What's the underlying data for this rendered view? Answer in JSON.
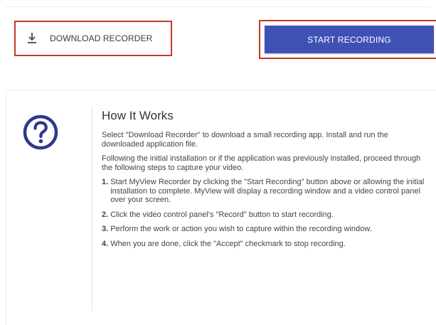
{
  "actions": {
    "download_label": "DOWNLOAD RECORDER",
    "start_label": "START RECORDING",
    "accent_color": "#3f51b5",
    "highlight_color": "#c0392b",
    "download_icon": "download-icon"
  },
  "how_it_works": {
    "icon": "question-circle-icon",
    "title": "How It Works",
    "paragraphs": [
      "Select \"Download Recorder\" to download a small recording app. Install and run the downloaded application file.",
      "Following the initial installation or if the application was previously installed, proceed through the following steps to capture your video."
    ],
    "steps": [
      {
        "num": "1.",
        "text": "Start MyView Recorder by clicking the \"Start Recording\" button above or allowing the initial installation to complete. MyView will display a recording window and a video control panel over your screen."
      },
      {
        "num": "2.",
        "text": "Click the video control panel's \"Record\" button to start recording."
      },
      {
        "num": "3.",
        "text": "Perform the work or action you wish to capture within the recording window."
      },
      {
        "num": "4.",
        "text": "When you are done, click the \"Accept\" checkmark to stop recording."
      }
    ]
  }
}
